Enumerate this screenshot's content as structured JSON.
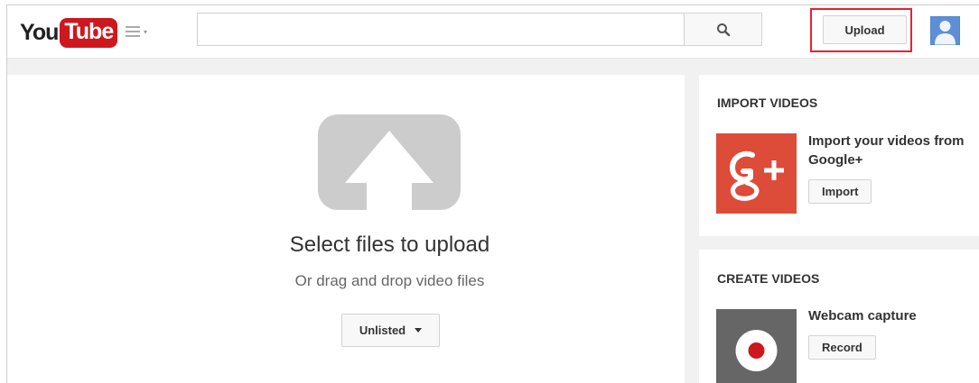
{
  "header": {
    "logo_you": "You",
    "logo_tube": "Tube",
    "search_value": "",
    "search_placeholder": "",
    "upload_label": "Upload"
  },
  "main": {
    "title": "Select files to upload",
    "subtitle": "Or drag and drop video files",
    "privacy_value": "Unlisted"
  },
  "import_card": {
    "heading": "IMPORT VIDEOS",
    "item_title": "Import your videos from Google+",
    "button_label": "Import"
  },
  "create_card": {
    "heading": "CREATE VIDEOS",
    "item_title": "Webcam capture",
    "button_label": "Record"
  },
  "icons": {
    "search": "search-icon",
    "menu": "menu-icon",
    "upload_arrow": "upload-arrow-icon",
    "google_plus": "google-plus-icon",
    "record": "record-icon",
    "avatar": "user-avatar-icon"
  },
  "colors": {
    "brand_red": "#cc181e",
    "highlight": "#e8203a",
    "google_plus": "#dd4b39",
    "avatar_blue": "#5d8fd6"
  }
}
